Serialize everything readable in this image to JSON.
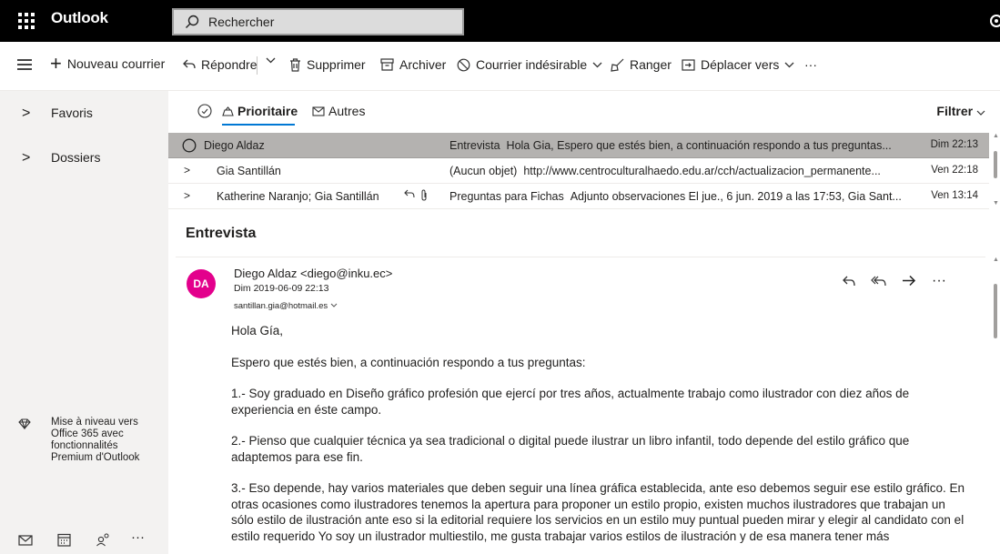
{
  "app": {
    "name": "Outlook"
  },
  "search": {
    "placeholder": "Rechercher"
  },
  "command_bar": {
    "new_mail": "Nouveau courrier",
    "reply": "Répondre",
    "delete": "Supprimer",
    "archive": "Archiver",
    "junk": "Courrier indésirable",
    "sweep": "Ranger",
    "move_to": "Déplacer vers",
    "more": "···"
  },
  "sidebar": {
    "items": [
      {
        "label": "Favoris"
      },
      {
        "label": "Dossiers"
      }
    ],
    "upgrade_text": "Mise à niveau vers Office 365 avec fonctionnalités Premium d'Outlook",
    "bottom_icons": [
      "mail-icon",
      "calendar-icon",
      "people-icon",
      "more-icon"
    ]
  },
  "pivot": {
    "focused": "Prioritaire",
    "other": "Autres",
    "filter": "Filtrer"
  },
  "messages": [
    {
      "sender": "Diego Aldaz",
      "subject": "Entrevista",
      "preview": "Hola Gia, Espero que estés bien, a continuación respondo a tus preguntas...",
      "date": "Dim 22:13",
      "selected": true
    },
    {
      "sender": "Gia Santillán",
      "subject": "(Aucun objet)",
      "preview": "http://www.centroculturalhaedo.edu.ar/cch/actualizacion_permanente...",
      "date": "Ven 22:18",
      "selected": false
    },
    {
      "sender": "Katherine Naranjo; Gia Santillán",
      "subject": "Preguntas para Fichas",
      "preview": "Adjunto observaciones El jue., 6 jun. 2019 a las 17:53, Gia Sant...",
      "date": "Ven 13:14",
      "selected": false
    }
  ],
  "reading": {
    "title": "Entrevista",
    "avatar_initials": "DA",
    "avatar_color": "#e3008c",
    "from": "Diego Aldaz <diego@inku.ec>",
    "sent": "Dim 2019-06-09 22:13",
    "to": "santillan.gia@hotmail.es",
    "more": "···",
    "body": [
      "Hola Gía,",
      "Espero que estés bien, a continuación respondo a tus preguntas:",
      "1.- Soy graduado en Diseño gráfico profesión que ejercí por tres años, actualmente trabajo como ilustrador con diez años de experiencia en éste campo.",
      "2.- Pienso que cualquier técnica ya sea tradicional o digital puede ilustrar un libro infantil, todo depende del estilo gráfico que adaptemos para ese fin.",
      "3.- Eso depende, hay varios materiales que deben seguir una línea gráfica establecida, ante eso debemos seguir ese estilo gráfico. En otras ocasiones como ilustradores tenemos la apertura para proponer un estilo propio, existen muchos ilustradores que trabajan un sólo estilo de ilustración ante eso si la editorial requiere los servicios en un estilo muy puntual pueden mirar y elegir al candidato con el estilo requerido Yo soy un ilustrador multiestilo, me gusta trabajar varios estilos de ilustración y de esa manera tener más"
    ]
  }
}
